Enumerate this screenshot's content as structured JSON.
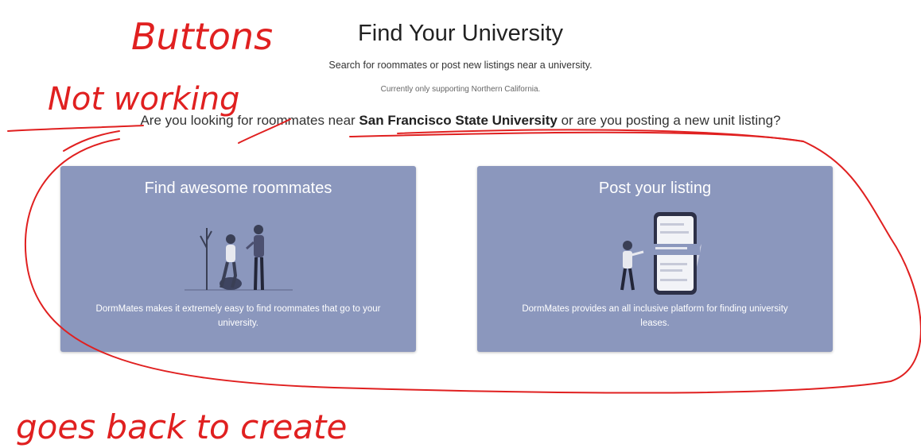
{
  "header": {
    "title": "Find Your University",
    "subtitle": "Search for roommates or post new listings near a university.",
    "note": "Currently only supporting Northern California."
  },
  "question": {
    "prefix": "Are you looking for roommates near ",
    "university": "San Francisco State University",
    "suffix": " or are you posting a new unit listing?"
  },
  "cards": [
    {
      "title": "Find awesome roommates",
      "description": "DormMates makes it extremely easy to find roommates that go to your university.",
      "illustration": "roommates-illustration"
    },
    {
      "title": "Post your listing",
      "description": "DormMates provides an all inclusive platform for finding university leases.",
      "illustration": "phone-listing-illustration"
    }
  ],
  "annotations": {
    "top_left_line1": "Buttons",
    "top_left_line2": "Not working",
    "bottom": "goes back to create",
    "ink_color": "#e02020"
  },
  "colors": {
    "card_bg": "#8b97bd",
    "card_text": "#ffffff"
  }
}
